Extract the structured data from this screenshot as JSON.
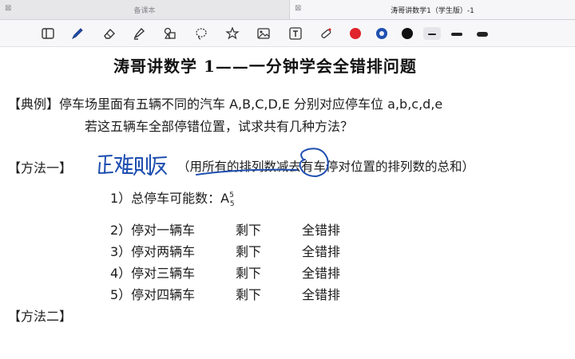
{
  "tabs": {
    "inactive": {
      "label": "备课本",
      "close": "⊠"
    },
    "active": {
      "label": "涛哥讲数学1（学生版）-1",
      "close": "⊠"
    }
  },
  "toolbar": {
    "icons": [
      "sidebar-icon",
      "pen-icon",
      "eraser-icon",
      "highlighter-icon",
      "shapes-icon",
      "lasso-icon",
      "sticker-icon",
      "image-icon",
      "textbox-icon",
      "laser-pointer-icon"
    ],
    "colors": [
      "#e0242b",
      "#1f4fb0",
      "#111111"
    ],
    "selected_color": "#1f4fb0",
    "stroke_widths": [
      "thin",
      "medium",
      "thick"
    ]
  },
  "content": {
    "title": "涛哥讲数学 1——一分钟学会全错排问题",
    "example_tag": "【典例】",
    "example_line1": "停车场里面有五辆不同的汽车 A,B,C,D,E 分别对应停车位 a,b,c,d,e",
    "example_line2": "若这五辆车全部停错位置，试求共有几种方法？",
    "method1_tag": "【方法一】",
    "handwritten_note": "正难则反",
    "method1_desc": "（用所有的排列数减去有车停对位置的排列数的总和）",
    "step1_text": "1）总停车可能数：A",
    "step1_sup": "5",
    "step1_sub": "5",
    "steps": [
      {
        "num": "2）停对一辆车",
        "rest": "剩下",
        "type": "全错排"
      },
      {
        "num": "3）停对两辆车",
        "rest": "剩下",
        "type": "全错排"
      },
      {
        "num": "4）停对三辆车",
        "rest": "剩下",
        "type": "全错排"
      },
      {
        "num": "5）停对四辆车",
        "rest": "剩下",
        "type": "全错排"
      }
    ],
    "method2_tag": "【方法二】"
  }
}
